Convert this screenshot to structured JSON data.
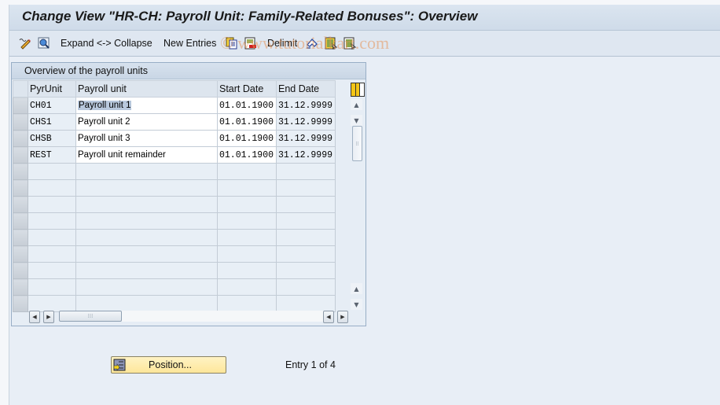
{
  "window": {
    "title": "Change View \"HR-CH: Payroll Unit: Family-Related Bonuses\": Overview"
  },
  "toolbar": {
    "items": [
      {
        "icon": "display-change-icon",
        "label": ""
      },
      {
        "icon": "find-icon",
        "label": ""
      },
      {
        "icon": "",
        "label": "Expand <-> Collapse"
      },
      {
        "icon": "",
        "label": "New Entries"
      },
      {
        "icon": "copy-as-icon",
        "label": ""
      },
      {
        "icon": "delete-icon",
        "label": ""
      },
      {
        "icon": "",
        "label": "Delimit"
      },
      {
        "icon": "undo-change-icon",
        "label": ""
      },
      {
        "icon": "select-all-icon",
        "label": ""
      },
      {
        "icon": "deselect-all-icon",
        "label": ""
      }
    ],
    "watermark": "© www.tutorialkart.com"
  },
  "panel": {
    "title": "Overview of the payroll units",
    "columns": [
      "PyrUnit",
      "Payroll unit",
      "Start Date",
      "End Date"
    ],
    "rows": [
      {
        "code": "CH01",
        "name": "Payroll unit 1",
        "start": "01.01.1900",
        "end": "31.12.9999",
        "selected_text": true
      },
      {
        "code": "CHS1",
        "name": "Payroll unit 2",
        "start": "01.01.1900",
        "end": "31.12.9999"
      },
      {
        "code": "CHSB",
        "name": "Payroll unit 3",
        "start": "01.01.1900",
        "end": "31.12.9999"
      },
      {
        "code": "REST",
        "name": "Payroll unit remainder",
        "start": "01.01.1900",
        "end": "31.12.9999"
      }
    ],
    "empty_rows": 9,
    "column_settings_icon": "table-settings-icon"
  },
  "footer": {
    "position_button": "Position...",
    "entry_info": "Entry 1 of 4"
  }
}
